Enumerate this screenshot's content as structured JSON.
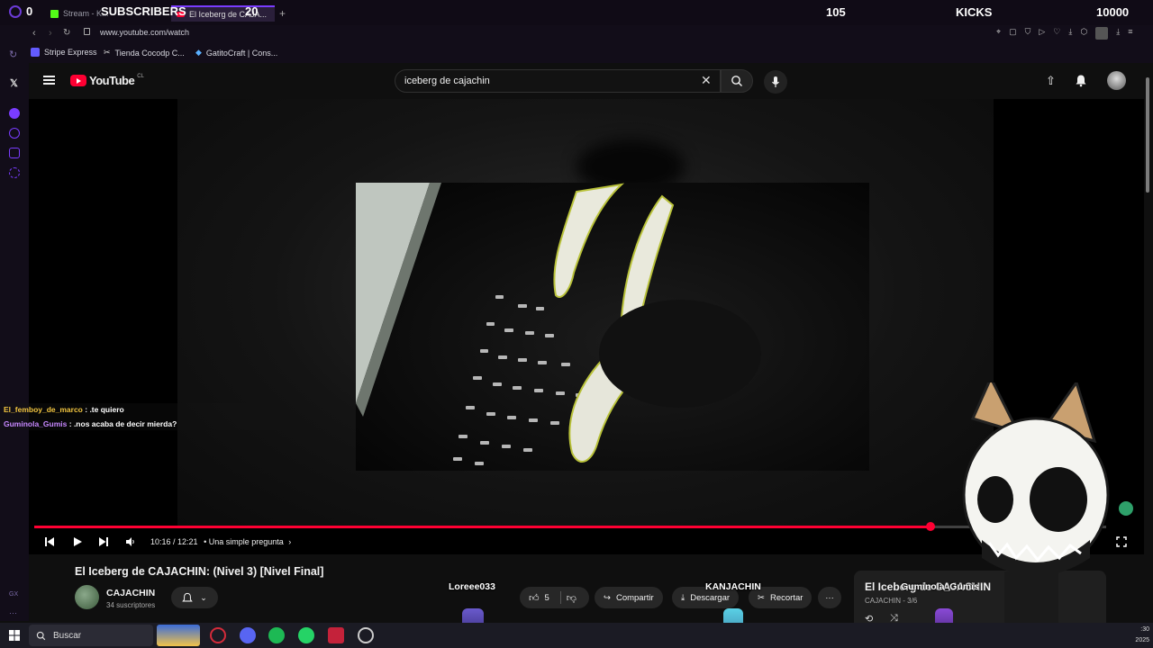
{
  "stream_overlay": {
    "subscribers_count": "0",
    "subscribers_label": "SUBSCRIBERS",
    "subscribers_goal": "20",
    "kicks_count": "105",
    "kicks_label": "KICKS",
    "kicks_goal": "10000"
  },
  "browser": {
    "tabs": [
      {
        "label": "Stream - K..."
      },
      {
        "label": "El Iceberg de CAJA..."
      }
    ],
    "url": "www.youtube.com/watch",
    "bookmarks": [
      {
        "label": "Stripe Express"
      },
      {
        "label": "Tienda Cocodp C..."
      },
      {
        "label": "GatitoCraft | Cons..."
      }
    ]
  },
  "youtube": {
    "logo_text": "YouTube",
    "logo_region": "CL",
    "search_query": "iceberg de cajachin",
    "player": {
      "time": "10:16 / 12:21",
      "chapter": "• Una simple pregunta",
      "progress": 0.8365
    },
    "video": {
      "title": "El Iceberg de CAJACHIN: (Nivel 3) [Nivel Final]",
      "channel": "CAJACHIN",
      "subscribers": "34 suscriptores",
      "likes": "5",
      "share_label": "Compartir",
      "download_label": "Descargar",
      "clip_label": "Recortar"
    },
    "playlist_panel": {
      "title": "El Iceberg de CAJACHIN",
      "subtitle": "CAJACHIN - 3/6"
    }
  },
  "chat": [
    {
      "user": "El_femboy_de_marco",
      "user_color": "#f3c640",
      "message": ": .te quiero"
    },
    {
      "user": "Guminola_Gumis",
      "user_color": "#c788ff",
      "message": ": .nos acaba de decir mierda?"
    }
  ],
  "viewers": {
    "names": [
      "Loreee033",
      "KANJACHIN",
      "Guminola_Gumis"
    ]
  },
  "taskbar": {
    "search_label": "Buscar",
    "clock_time": ":30",
    "clock_date": "2025"
  },
  "sidebar_badge": "GX",
  "colors": {
    "accent_red": "#ff0033",
    "browser_purple": "#7a3cff"
  }
}
